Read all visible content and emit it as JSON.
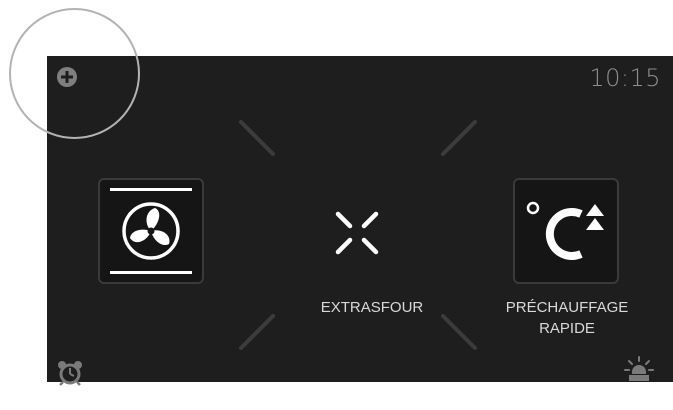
{
  "status_bar": {
    "time": "10:15"
  },
  "functions": {
    "extra_label": "EXTRASFOUR",
    "boost_line1": "PRÉCHAUFFAGE",
    "boost_line2": "RAPIDE"
  },
  "icons": {
    "add": "plus-circle-icon",
    "fan": "fan-convection-icon",
    "extra_sfour": "extra-cross-icon",
    "rapid_preheat": "degree-c-up-arrows-icon",
    "timer": "alarm-clock-icon",
    "light": "oven-light-icon"
  },
  "colors": {
    "screen_background": "#1e1e1e",
    "icon_white": "#ffffff",
    "dim_grey": "#8e8e8e",
    "highlight_ring": "#b3b3b3"
  }
}
